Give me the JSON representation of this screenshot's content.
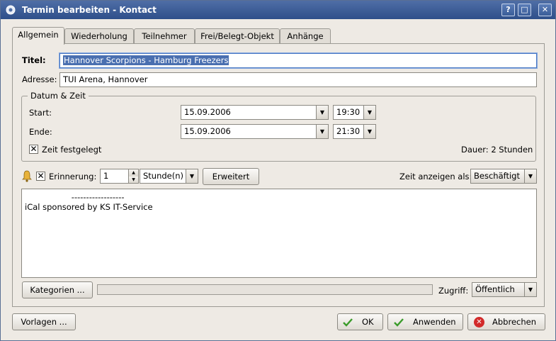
{
  "window": {
    "title": "Termin bearbeiten - Kontact"
  },
  "titlebar_buttons": {
    "help": "?",
    "maximize": "□",
    "close": "✕"
  },
  "tabs": [
    {
      "label": "Allgemein",
      "active": true
    },
    {
      "label": "Wiederholung",
      "active": false
    },
    {
      "label": "Teilnehmer",
      "active": false
    },
    {
      "label": "Frei/Belegt-Objekt",
      "active": false
    },
    {
      "label": "Anhänge",
      "active": false
    }
  ],
  "general": {
    "title_label": "Titel:",
    "title_value": "Hannover Scorpions - Hamburg Freezers",
    "address_label": "Adresse:",
    "address_value": "TUI Arena, Hannover"
  },
  "datetime": {
    "group_title": "Datum & Zeit",
    "start_label": "Start:",
    "start_date": "15.09.2006",
    "start_time": "19:30",
    "end_label": "Ende:",
    "end_date": "15.09.2006",
    "end_time": "21:30",
    "fixed_label": "Zeit festgelegt",
    "fixed_checked": true,
    "duration": "Dauer: 2 Stunden"
  },
  "reminder": {
    "checked": true,
    "label": "Erinnerung:",
    "value": "1",
    "unit": "Stunde(n)",
    "advanced_button": "Erweitert",
    "show_time_label": "Zeit anzeigen als:",
    "show_time_value": "Beschäftigt"
  },
  "description": "                  ------------------\niCal sponsored by KS IT-Service",
  "bottom_panel": {
    "categories_button": "Kategorien ...",
    "access_label": "Zugriff:",
    "access_value": "Öffentlich"
  },
  "footer": {
    "templates_button": "Vorlagen ...",
    "ok_button": "OK",
    "apply_button": "Anwenden",
    "cancel_button": "Abbrechen"
  },
  "colors": {
    "titlebar": "#2e4f8a",
    "selection": "#4a6fb0",
    "ok_check": "#3a9b2a",
    "cancel_red": "#d22a2a"
  }
}
